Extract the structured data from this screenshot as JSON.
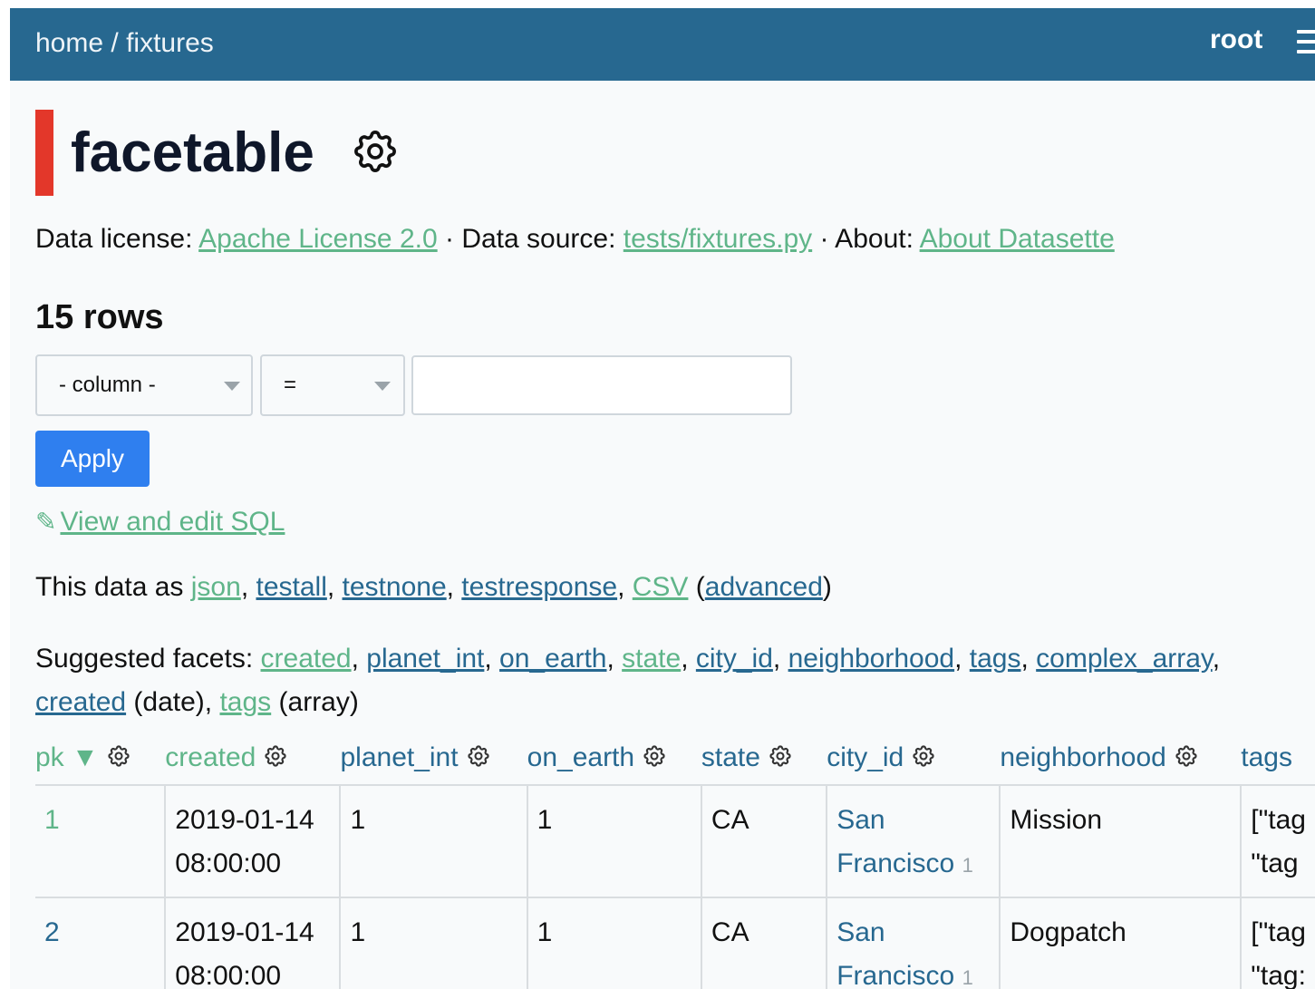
{
  "nav": {
    "home": "home",
    "separator": "/",
    "database": "fixtures",
    "user": "root",
    "menu_icon": "hamburger-menu-icon"
  },
  "page": {
    "title": "facetable",
    "settings_icon": "gear-icon"
  },
  "metadata": {
    "license_label": "Data license:",
    "license_link": "Apache License 2.0",
    "source_label": "· Data source:",
    "source_link": "tests/fixtures.py",
    "about_label": "· About:",
    "about_link": "About Datasette"
  },
  "row_count": "15 rows",
  "filter": {
    "column_select": "- column -",
    "operator_select": "=",
    "value": "",
    "apply_label": "Apply"
  },
  "sql_link": "View and edit SQL",
  "export": {
    "prefix": "This data as",
    "formats": [
      "json",
      "testall",
      "testnone",
      "testresponse",
      "CSV"
    ],
    "advanced": "advanced"
  },
  "facets": {
    "label": "Suggested facets:",
    "items": [
      "created",
      "planet_int",
      "on_earth",
      "state",
      "city_id",
      "neighborhood",
      "tags",
      "complex_array"
    ],
    "line2": [
      {
        "name": "created",
        "kind": "(date)"
      },
      {
        "name": "tags",
        "kind": "(array)"
      }
    ]
  },
  "table": {
    "columns": [
      "pk",
      "created",
      "planet_int",
      "on_earth",
      "state",
      "city_id",
      "neighborhood",
      "tags"
    ],
    "sort_indicator": "▼",
    "rows": [
      {
        "pk": "1",
        "created_date": "2019-01-14",
        "created_time": "08:00:00",
        "planet_int": "1",
        "on_earth": "1",
        "state": "CA",
        "city_1": "San",
        "city_2": "Francisco",
        "city_pk": "1",
        "neighborhood": "Mission",
        "tags_1": "[\"tag",
        "tags_2": "\"tag"
      },
      {
        "pk": "2",
        "created_date": "2019-01-14",
        "created_time": "08:00:00",
        "planet_int": "1",
        "on_earth": "1",
        "state": "CA",
        "city_1": "San",
        "city_2": "Francisco",
        "city_pk": "1",
        "neighborhood": "Dogpatch",
        "tags_1": "[\"tag",
        "tags_2": "\"tag:"
      }
    ]
  },
  "colors": {
    "header_bg": "#276890",
    "accent_red": "#e3372a",
    "link_green": "#5fb589",
    "link_blue": "#276890",
    "button_blue": "#2f7fef"
  }
}
